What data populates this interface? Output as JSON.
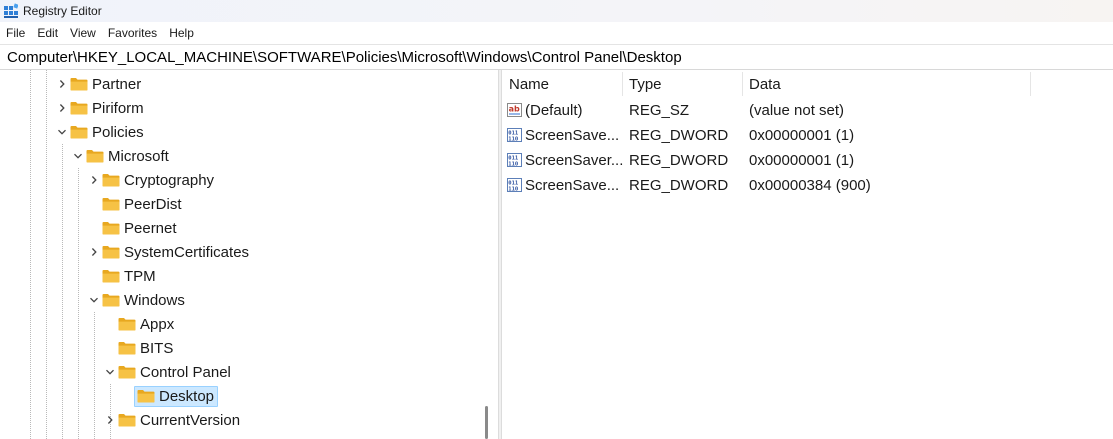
{
  "window": {
    "title": "Registry Editor"
  },
  "menu": [
    "File",
    "Edit",
    "View",
    "Favorites",
    "Help"
  ],
  "address": "Computer\\HKEY_LOCAL_MACHINE\\SOFTWARE\\Policies\\Microsoft\\Windows\\Control Panel\\Desktop",
  "tree": [
    {
      "label": "Partner",
      "expander": "collapsed"
    },
    {
      "label": "Piriform",
      "expander": "collapsed"
    },
    {
      "label": "Policies",
      "expander": "expanded"
    },
    {
      "label": "Microsoft",
      "expander": "expanded"
    },
    {
      "label": "Cryptography",
      "expander": "collapsed"
    },
    {
      "label": "PeerDist",
      "expander": "none"
    },
    {
      "label": "Peernet",
      "expander": "none"
    },
    {
      "label": "SystemCertificates",
      "expander": "collapsed"
    },
    {
      "label": "TPM",
      "expander": "none"
    },
    {
      "label": "Windows",
      "expander": "expanded"
    },
    {
      "label": "Appx",
      "expander": "none"
    },
    {
      "label": "BITS",
      "expander": "none"
    },
    {
      "label": "Control Panel",
      "expander": "expanded"
    },
    {
      "label": "Desktop",
      "expander": "none",
      "selected": true
    },
    {
      "label": "CurrentVersion",
      "expander": "collapsed"
    }
  ],
  "list": {
    "columns": [
      "Name",
      "Type",
      "Data"
    ],
    "rows": [
      {
        "icon": "string-value-icon",
        "name": "(Default)",
        "type": "REG_SZ",
        "data": "(value not set)"
      },
      {
        "icon": "binary-value-icon",
        "name": "ScreenSave...",
        "type": "REG_DWORD",
        "data": "0x00000001 (1)"
      },
      {
        "icon": "binary-value-icon",
        "name": "ScreenSaver...",
        "type": "REG_DWORD",
        "data": "0x00000001 (1)"
      },
      {
        "icon": "binary-value-icon",
        "name": "ScreenSave...",
        "type": "REG_DWORD",
        "data": "0x00000384 (900)"
      }
    ]
  },
  "colors": {
    "selection_bg": "#cce8ff",
    "selection_border": "#99d1ff",
    "folder": "#f6c245"
  }
}
